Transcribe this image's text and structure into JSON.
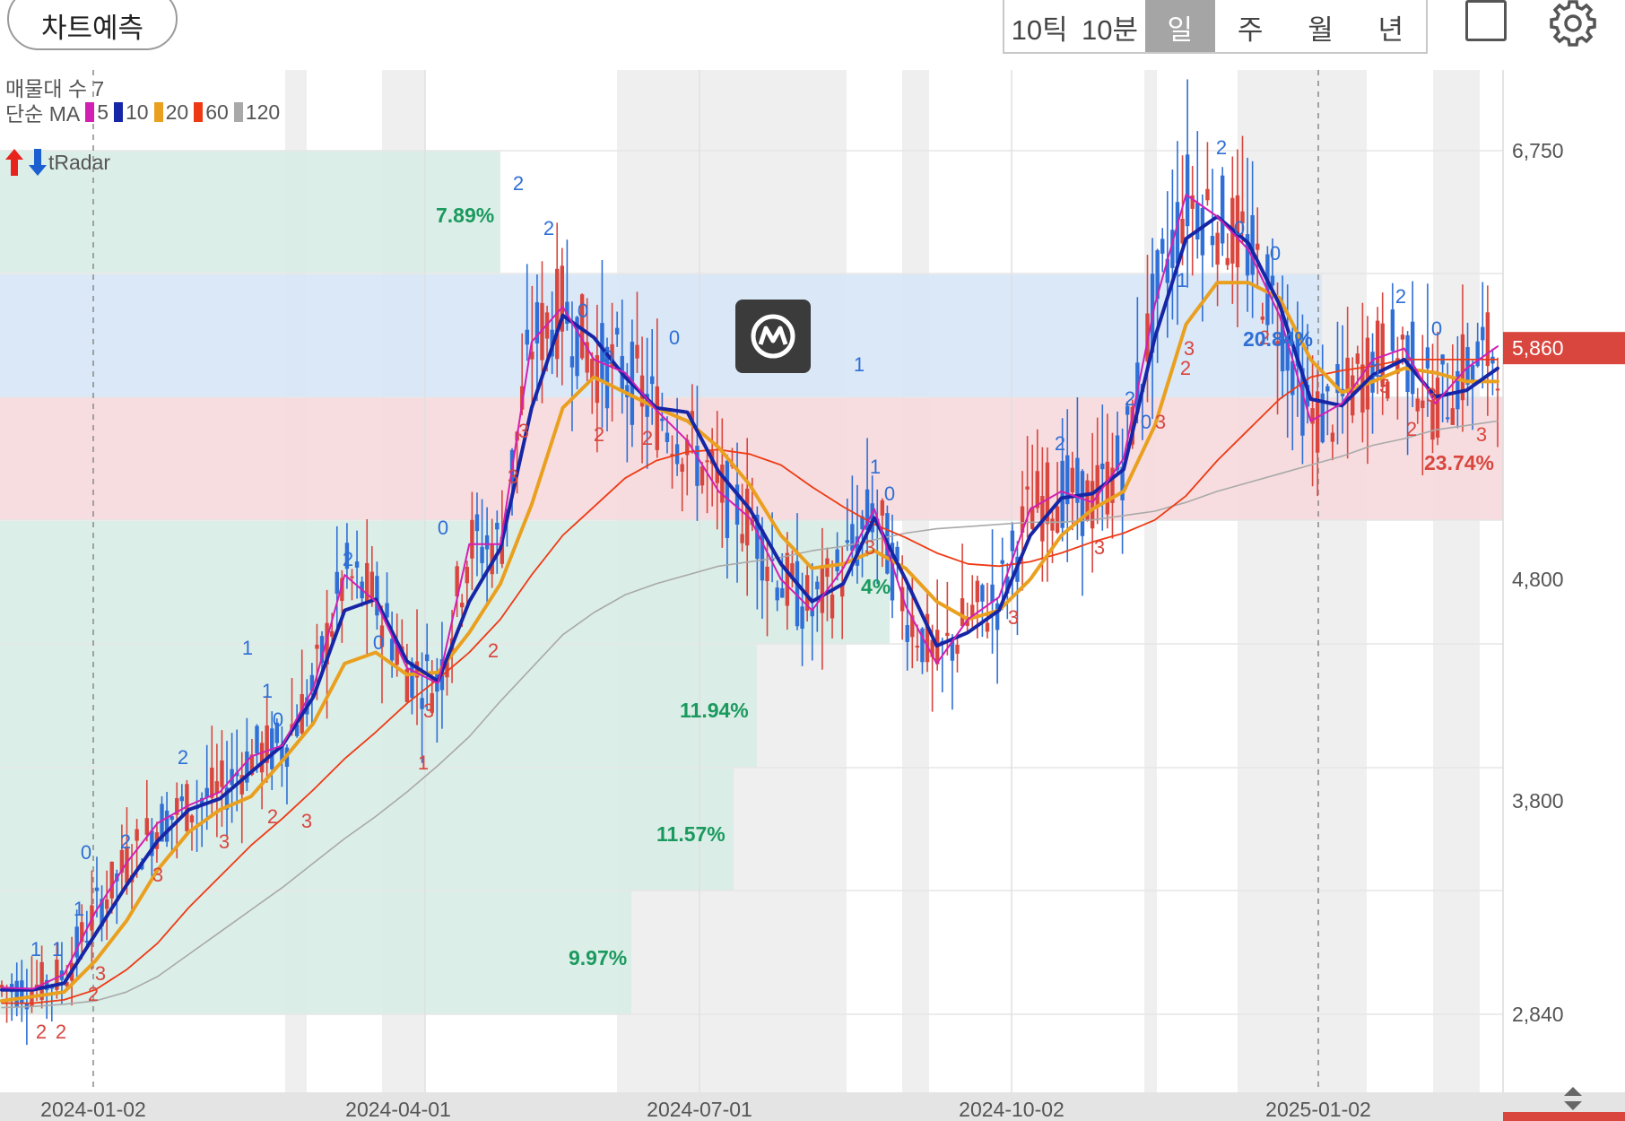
{
  "topbar": {
    "forecast_label": "차트예측",
    "periods": [
      "10틱",
      "10분",
      "일",
      "주",
      "월",
      "년"
    ],
    "active_period": "일"
  },
  "legend": {
    "volume_profile": "매물대 수 7",
    "ma_label": "단순 MA",
    "ma_periods": [
      "5",
      "10",
      "20",
      "60",
      "120"
    ],
    "ma_colors": [
      "#d21fb4",
      "#1626a6",
      "#eaa01f",
      "#ee3a14",
      "#a9a9a9"
    ],
    "tradar": "tRadar"
  },
  "price_axis": {
    "ticks": [
      "6,750",
      "4,800",
      "3,800",
      "2,840"
    ],
    "last_price": "5,860",
    "last_price_color": "#d9463e"
  },
  "time_axis": {
    "ticks": [
      "2024-01-02",
      "2024-04-01",
      "2024-07-01",
      "2024-10-02",
      "2025-01-02"
    ]
  },
  "zones": [
    {
      "label": "7.89%",
      "color": "green"
    },
    {
      "label": "20.84%",
      "color": "blue"
    },
    {
      "label": "23.74%",
      "color": "red"
    },
    {
      "label": "4%",
      "color": "green"
    },
    {
      "label": "11.94%",
      "color": "green"
    },
    {
      "label": "11.57%",
      "color": "green"
    },
    {
      "label": "9.97%",
      "color": "green"
    }
  ],
  "chart_data": {
    "type": "candlestick",
    "y_ticks": [
      2840,
      3800,
      4800,
      6750
    ],
    "x_ticks": [
      "2024-01-02",
      "2024-04-01",
      "2024-07-01",
      "2024-10-02",
      "2025-01-02"
    ],
    "last_price": 5860,
    "series": [
      {
        "name": "5",
        "values": [
          2960,
          2955,
          3020,
          3300,
          3520,
          3700,
          3780,
          3840,
          4000,
          4050,
          4310,
          4820,
          4700,
          4400,
          4330,
          4960,
          4960,
          5880,
          6040,
          5800,
          5740,
          5570,
          5430,
          5200,
          5080,
          4800,
          4660,
          4850,
          5120,
          4680,
          4420,
          4620,
          4720,
          5120,
          5200,
          5150,
          5350,
          6050,
          6550,
          6450,
          6300,
          6000,
          5520,
          5600,
          5800,
          5850,
          5600,
          5760,
          5860
        ]
      },
      {
        "name": "10",
        "values": [
          2950,
          2950,
          2980,
          3200,
          3420,
          3620,
          3760,
          3810,
          3930,
          4050,
          4270,
          4660,
          4710,
          4430,
          4340,
          4700,
          4940,
          5580,
          6000,
          5900,
          5720,
          5580,
          5560,
          5290,
          5120,
          4870,
          4700,
          4780,
          5080,
          4800,
          4500,
          4560,
          4660,
          5000,
          5170,
          5190,
          5300,
          5900,
          6350,
          6450,
          6330,
          6050,
          5620,
          5590,
          5730,
          5800,
          5630,
          5660,
          5760
        ]
      },
      {
        "name": "20",
        "values": [
          2900,
          2920,
          2940,
          3080,
          3260,
          3490,
          3660,
          3760,
          3820,
          3980,
          4150,
          4420,
          4470,
          4370,
          4380,
          4560,
          4780,
          5140,
          5580,
          5720,
          5650,
          5580,
          5520,
          5400,
          5230,
          5000,
          4850,
          4870,
          4930,
          4850,
          4700,
          4620,
          4660,
          4800,
          5000,
          5120,
          5200,
          5500,
          5960,
          6150,
          6150,
          6080,
          5800,
          5650,
          5700,
          5760,
          5740,
          5700,
          5700
        ]
      },
      {
        "name": "60",
        "values": [
          2890,
          2890,
          2905,
          2950,
          3040,
          3160,
          3320,
          3460,
          3600,
          3720,
          3850,
          3990,
          4110,
          4240,
          4350,
          4470,
          4620,
          4820,
          5000,
          5130,
          5260,
          5340,
          5380,
          5390,
          5370,
          5320,
          5220,
          5130,
          5050,
          4990,
          4920,
          4870,
          4860,
          4880,
          4920,
          4970,
          5010,
          5070,
          5180,
          5340,
          5480,
          5620,
          5720,
          5750,
          5770,
          5800,
          5800,
          5800,
          5800
        ]
      },
      {
        "name": "120",
        "values": [
          2870,
          2875,
          2885,
          2900,
          2940,
          3010,
          3110,
          3210,
          3310,
          3410,
          3520,
          3630,
          3730,
          3840,
          3960,
          4090,
          4250,
          4400,
          4550,
          4650,
          4730,
          4780,
          4820,
          4860,
          4880,
          4900,
          4930,
          4950,
          4980,
          5010,
          5030,
          5040,
          5050,
          5060,
          5060,
          5070,
          5090,
          5110,
          5150,
          5200,
          5240,
          5280,
          5320,
          5360,
          5410,
          5440,
          5480,
          5500,
          5520
        ]
      }
    ],
    "volume_profile_pct": [
      "7.89%",
      "20.84%",
      "23.74%",
      "4%",
      "11.94%",
      "11.57%",
      "9.97%"
    ]
  }
}
